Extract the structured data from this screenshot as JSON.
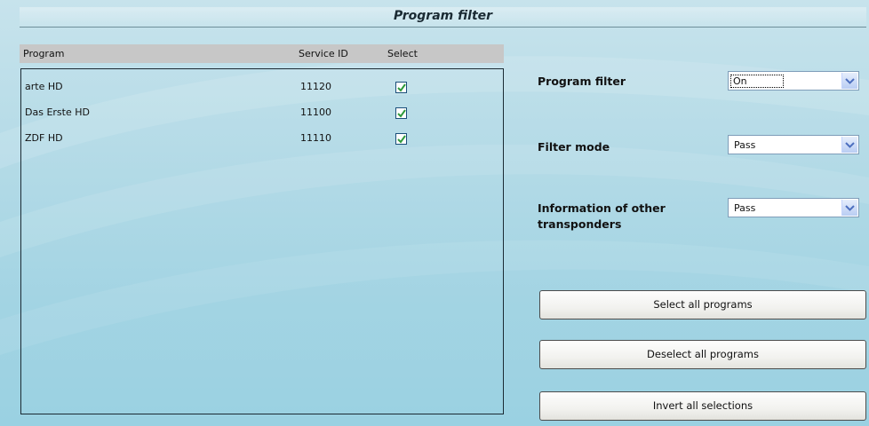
{
  "panel": {
    "title": "Program filter"
  },
  "table": {
    "headers": {
      "program": "Program",
      "service_id": "Service ID",
      "select": "Select"
    },
    "rows": [
      {
        "program": "arte HD",
        "service_id": "11120",
        "selected": true
      },
      {
        "program": "Das Erste HD",
        "service_id": "11100",
        "selected": true
      },
      {
        "program": "ZDF HD",
        "service_id": "11110",
        "selected": true
      }
    ]
  },
  "settings": {
    "program_filter": {
      "label": "Program filter",
      "value": "On"
    },
    "filter_mode": {
      "label": "Filter mode",
      "value": "Pass"
    },
    "other_transponders": {
      "label_line1": "Information of other",
      "label_line2": "transponders",
      "value": "Pass"
    }
  },
  "buttons": {
    "select_all": "Select all programs",
    "deselect_all": "Deselect all programs",
    "invert": "Invert all selections"
  },
  "colors": {
    "check": "#2e9a3a",
    "select_arrow": "#4d6fbf"
  },
  "icons": {
    "checkbox": "checkmark-icon",
    "dropdown": "chevron-down-icon"
  }
}
